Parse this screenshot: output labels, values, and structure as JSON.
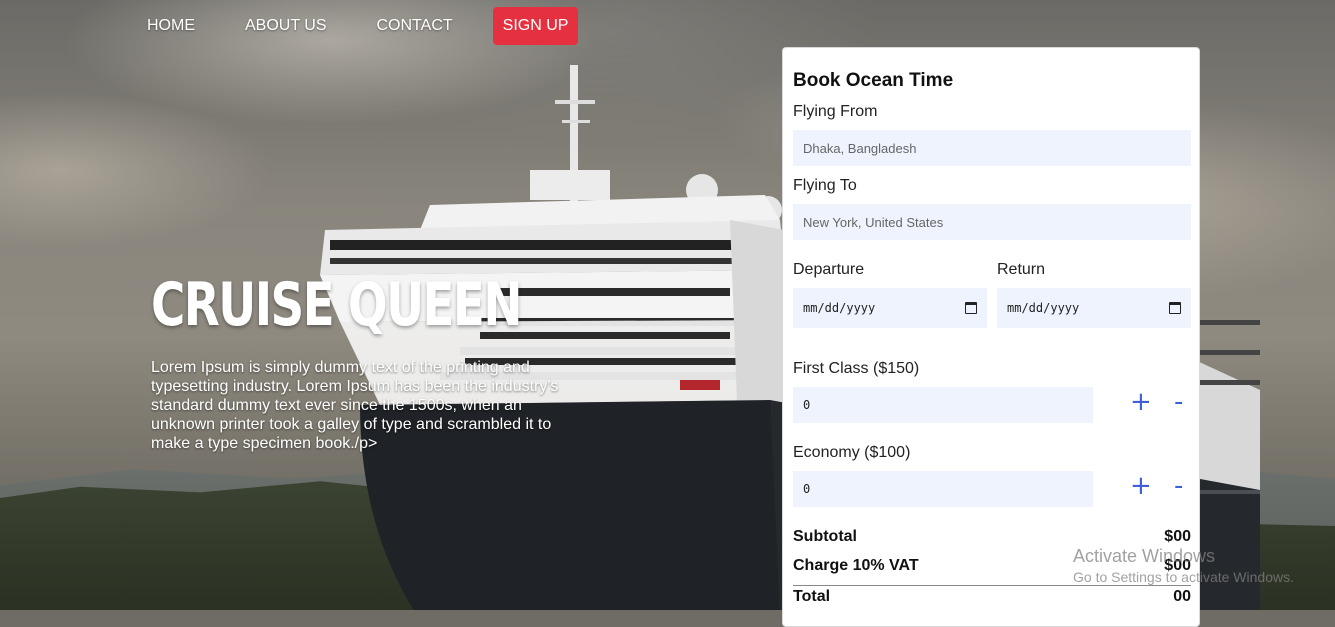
{
  "nav": {
    "items": [
      "HOME",
      "ABOUT US",
      "CONTACT"
    ],
    "signup": "SIGN UP"
  },
  "hero": {
    "title": "CRUISE QUEEN",
    "text": "Lorem Ipsum is simply dummy text of the printing and typesetting industry. Lorem Ipsum has been the industry's standard dummy text ever since the 1500s, when an unknown printer took a galley of type and scrambled it to make a type specimen book./p>"
  },
  "booking": {
    "title": "Book Ocean Time",
    "from_label": "Flying From",
    "from_placeholder": "Dhaka, Bangladesh",
    "to_label": "Flying To",
    "to_placeholder": "New York, United States",
    "departure_label": "Departure",
    "return_label": "Return",
    "date_placeholder": "mm/dd/yyyy",
    "first_class_label": "First Class ($150)",
    "first_class_value": "0",
    "economy_label": "Economy ($100)",
    "economy_value": "0",
    "plus": "+",
    "minus": "-",
    "subtotal_label": "Subtotal",
    "subtotal_value": "$00",
    "vat_label": "Charge 10% VAT",
    "vat_value": "$00",
    "total_label": "Total",
    "total_value": "00"
  },
  "watermark": {
    "line1": "Activate Windows",
    "line2": "Go to Settings to activate Windows."
  },
  "colors": {
    "signup_bg": "#e5303f",
    "field_bg": "#eef3fd",
    "stepper": "#3f5fd6"
  }
}
